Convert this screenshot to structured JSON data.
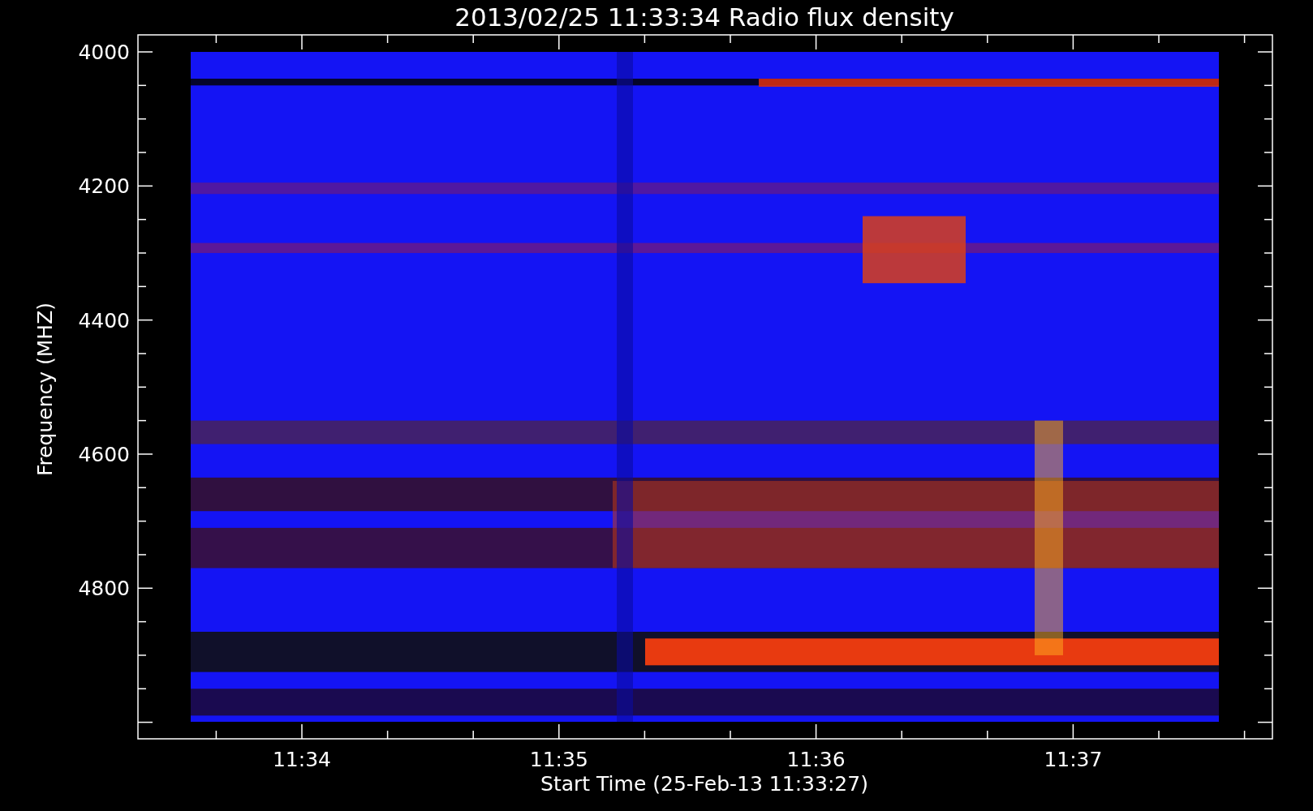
{
  "title": "2013/02/25 11:33:34 Radio flux density",
  "y_axis": {
    "label": "Frequency (MHZ)",
    "ticks": [
      "4000",
      "4200",
      "4400",
      "4600",
      "4800"
    ]
  },
  "x_axis": {
    "label": "Start Time (25-Feb-13 11:33:27)",
    "ticks": [
      "11:34",
      "11:35",
      "11:36",
      "11:37"
    ]
  }
}
